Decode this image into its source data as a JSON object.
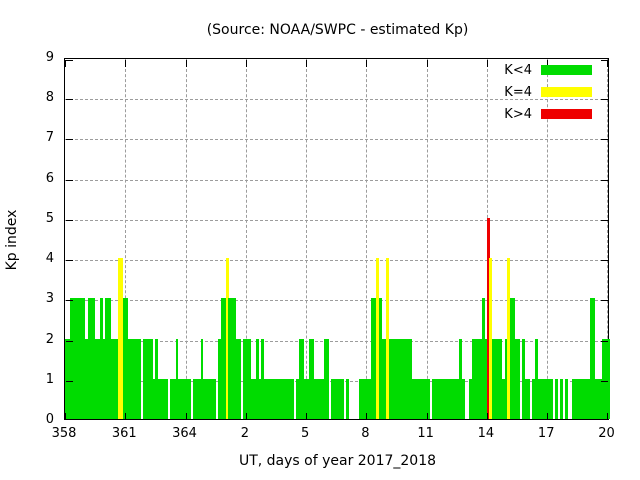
{
  "title": "(Source: NOAA/SWPC - estimated Kp)",
  "chart_data": {
    "type": "bar",
    "title": "(Source: NOAA/SWPC - estimated Kp)",
    "xlabel": "UT, days of year 2017_2018",
    "ylabel": "Kp index",
    "ylim": [
      0,
      9
    ],
    "grid": true,
    "legend_position": "top-right",
    "y_ticks": [
      0,
      1,
      2,
      3,
      4,
      5,
      6,
      7,
      8,
      9
    ],
    "x_ticks": [
      {
        "label": "358",
        "frac": 0.0
      },
      {
        "label": "361",
        "frac": 0.1106
      },
      {
        "label": "364",
        "frac": 0.2212
      },
      {
        "label": "2",
        "frac": 0.3318
      },
      {
        "label": "5",
        "frac": 0.4424
      },
      {
        "label": "8",
        "frac": 0.553
      },
      {
        "label": "11",
        "frac": 0.6636
      },
      {
        "label": "14",
        "frac": 0.7742
      },
      {
        "label": "17",
        "frac": 0.8848
      },
      {
        "label": "20",
        "frac": 0.9954
      }
    ],
    "bars_per_day": 8,
    "interval_hours": 3,
    "days": [
      "358",
      "359",
      "360",
      "361",
      "362",
      "363",
      "364",
      "365",
      "1",
      "2",
      "3",
      "4",
      "5",
      "6",
      "7",
      "8",
      "9",
      "10",
      "11",
      "12",
      "13",
      "14",
      "15",
      "16",
      "17",
      "18",
      "19",
      "20"
    ],
    "values": [
      2,
      2,
      3,
      3,
      3,
      3,
      3,
      3,
      2,
      3,
      3,
      3,
      2,
      2,
      3,
      2,
      3,
      3,
      2,
      2,
      2,
      4,
      4,
      3,
      3,
      2,
      2,
      2,
      2,
      2,
      0,
      2,
      2,
      2,
      2,
      1,
      2,
      1,
      1,
      1,
      1,
      0,
      1,
      1,
      2,
      1,
      1,
      1,
      1,
      1,
      0,
      1,
      1,
      1,
      2,
      1,
      1,
      1,
      1,
      1,
      0,
      2,
      3,
      3,
      4,
      3,
      3,
      3,
      2,
      2,
      0,
      2,
      2,
      2,
      1,
      1,
      2,
      1,
      2,
      1,
      1,
      1,
      1,
      1,
      1,
      1,
      1,
      1,
      1,
      1,
      1,
      0,
      1,
      2,
      2,
      1,
      1,
      2,
      2,
      1,
      1,
      1,
      1,
      2,
      2,
      0,
      1,
      1,
      1,
      1,
      1,
      0,
      1,
      0,
      0,
      0,
      0,
      1,
      1,
      1,
      1,
      1,
      3,
      3,
      4,
      3,
      2,
      2,
      4,
      2,
      2,
      2,
      2,
      2,
      2,
      2,
      2,
      2,
      1,
      1,
      1,
      1,
      1,
      1,
      1,
      0,
      1,
      1,
      1,
      1,
      1,
      1,
      1,
      1,
      1,
      1,
      1,
      2,
      1,
      0,
      0,
      1,
      2,
      2,
      2,
      2,
      3,
      2,
      5,
      4,
      2,
      2,
      2,
      2,
      1,
      2,
      4,
      3,
      3,
      2,
      2,
      0,
      2,
      1,
      1,
      0,
      1,
      2,
      1,
      1,
      1,
      1,
      1,
      1,
      0,
      1,
      0,
      1,
      0,
      1,
      0,
      0,
      1,
      1,
      1,
      1,
      1,
      1,
      1,
      3,
      3,
      1,
      1,
      1,
      2,
      2,
      2
    ],
    "colors": {
      "kp_lt_4": "#00dc00",
      "kp_eq_4": "#ffff00",
      "kp_gt_4": "#ee0000",
      "grid": "#9c9c9c",
      "frame": "#000000"
    },
    "legend": [
      {
        "label": "K<4",
        "color_key": "kp_lt_4"
      },
      {
        "label": "K=4",
        "color_key": "kp_eq_4"
      },
      {
        "label": "K>4",
        "color_key": "kp_gt_4"
      }
    ]
  }
}
